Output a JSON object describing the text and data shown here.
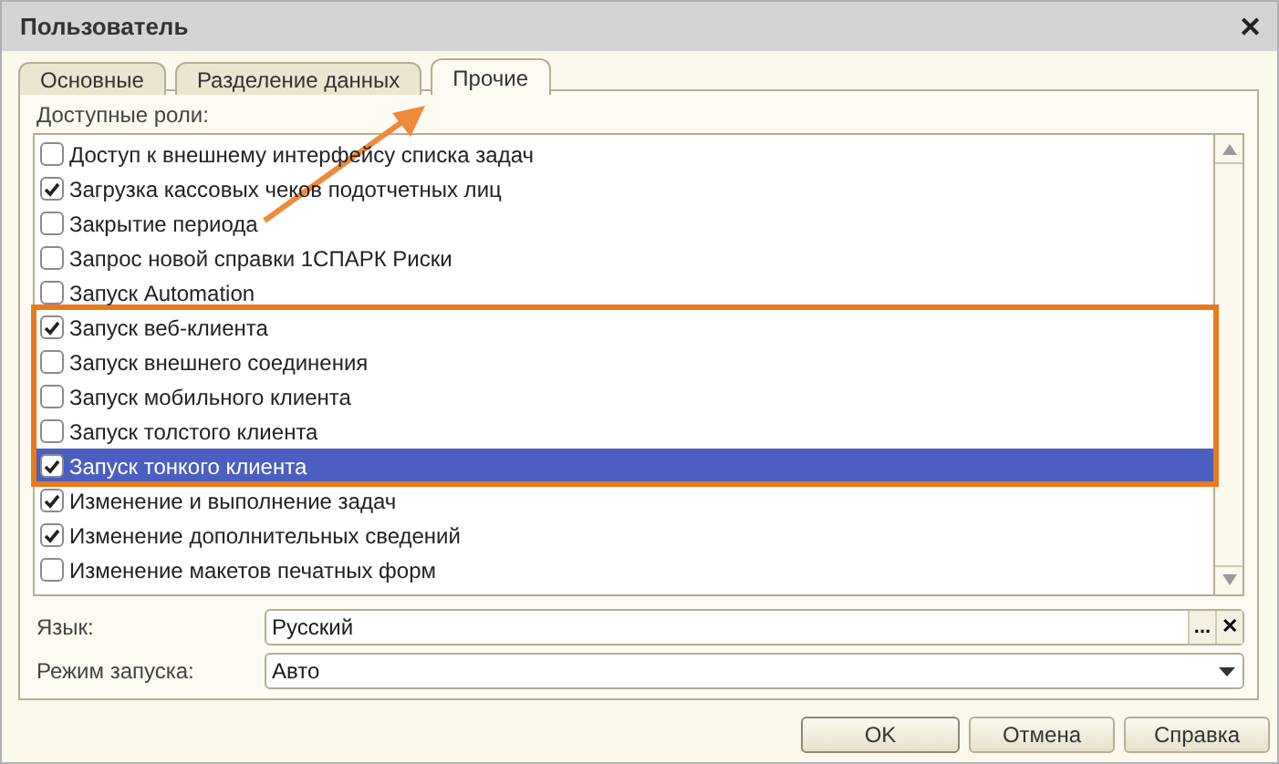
{
  "window": {
    "title": "Пользователь",
    "close": "✕"
  },
  "tabs": [
    {
      "label": "Основные",
      "selected": false
    },
    {
      "label": "Разделение данных",
      "selected": false
    },
    {
      "label": "Прочие",
      "selected": true
    }
  ],
  "roles": {
    "label": "Доступные роли:",
    "items": [
      {
        "text": "Доступ к внешнему интерфейсу списка задач",
        "checked": false,
        "selected": false
      },
      {
        "text": "Загрузка кассовых чеков подотчетных лиц",
        "checked": true,
        "selected": false
      },
      {
        "text": "Закрытие периода",
        "checked": false,
        "selected": false
      },
      {
        "text": "Запрос новой справки 1СПАРК Риски",
        "checked": false,
        "selected": false
      },
      {
        "text": "Запуск Automation",
        "checked": false,
        "selected": false
      },
      {
        "text": "Запуск веб-клиента",
        "checked": true,
        "selected": false
      },
      {
        "text": "Запуск внешнего соединения",
        "checked": false,
        "selected": false
      },
      {
        "text": "Запуск мобильного клиента",
        "checked": false,
        "selected": false
      },
      {
        "text": "Запуск толстого клиента",
        "checked": false,
        "selected": false
      },
      {
        "text": "Запуск тонкого клиента",
        "checked": true,
        "selected": true
      },
      {
        "text": "Изменение и выполнение задач",
        "checked": true,
        "selected": false
      },
      {
        "text": "Изменение дополнительных сведений",
        "checked": true,
        "selected": false
      },
      {
        "text": "Изменение макетов печатных форм",
        "checked": false,
        "selected": false
      }
    ]
  },
  "fields": [
    {
      "label": "Язык:",
      "value": "Русский",
      "kind": "select-clear",
      "buttons": [
        "...",
        "✕"
      ]
    },
    {
      "label": "Режим запуска:",
      "value": "Авто",
      "kind": "dropdown"
    }
  ],
  "buttons": [
    {
      "label": "OK",
      "default": true
    },
    {
      "label": "Отмена",
      "default": false
    },
    {
      "label": "Справка",
      "default": false
    }
  ]
}
